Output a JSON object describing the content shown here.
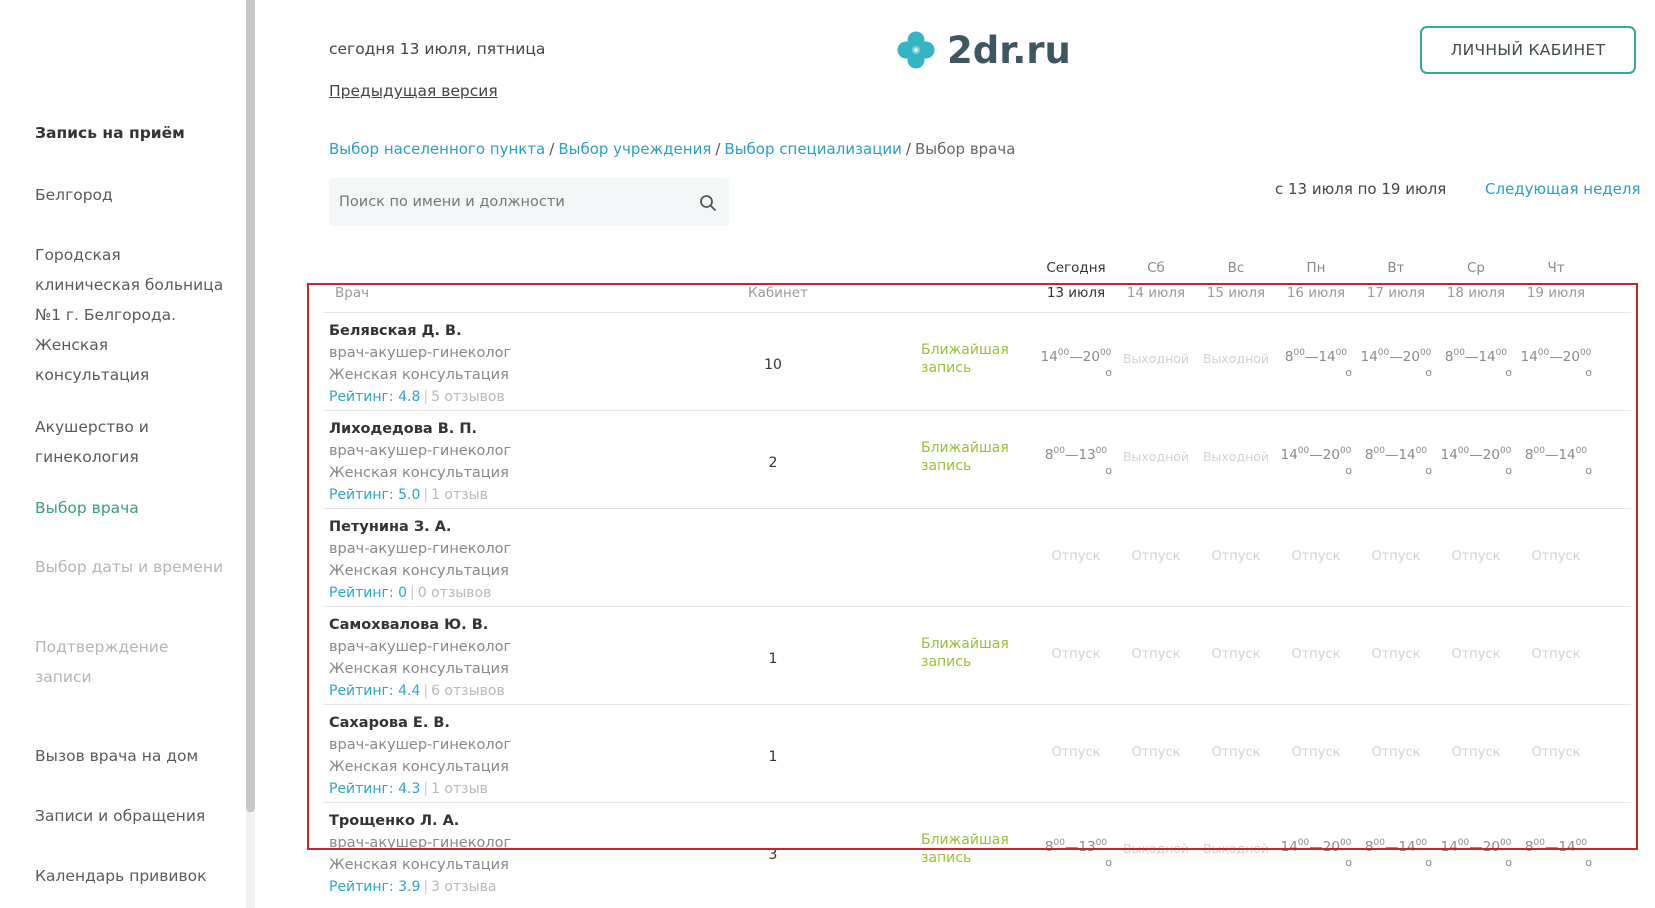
{
  "sidebar": {
    "items": [
      {
        "label": "Запись на приём",
        "state": "head"
      },
      {
        "label": "Белгород",
        "state": "normal"
      },
      {
        "label": "Городская клиническая больница №1 г. Белгорода. Женская консультация",
        "state": "normal"
      },
      {
        "label": "Акушерство и гинекология",
        "state": "normal"
      },
      {
        "label": "Выбор врача",
        "state": "active"
      },
      {
        "label": "Выбор даты и времени",
        "state": "muted"
      },
      {
        "label": "Подтверждение записи",
        "state": "muted"
      },
      {
        "label": "Вызов врача на дом",
        "state": "normal"
      },
      {
        "label": "Записи и обращения",
        "state": "normal"
      },
      {
        "label": "Календарь прививок",
        "state": "normal"
      }
    ]
  },
  "header": {
    "today": "сегодня 13 июля, пятница",
    "prev_version": "Предыдущая версия",
    "logo_text": "2dr.ru",
    "cabinet_button": "ЛИЧНЫЙ КАБИНЕТ"
  },
  "breadcrumb": {
    "links": [
      "Выбор населенного пункта",
      "Выбор учреждения",
      "Выбор специализации"
    ],
    "current": "Выбор врача",
    "separator": "/"
  },
  "search": {
    "placeholder": "Поиск по имени и должности"
  },
  "week": {
    "range": "с 13 июля по 19 июля",
    "next": "Следующая неделя"
  },
  "table": {
    "col_doctor": "Врач",
    "col_cabinet": "Кабинет",
    "days": [
      {
        "name": "Сегодня",
        "date": "13 июля",
        "today": true
      },
      {
        "name": "Сб",
        "date": "14 июля",
        "today": false
      },
      {
        "name": "Вс",
        "date": "15 июля",
        "today": false
      },
      {
        "name": "Пн",
        "date": "16 июля",
        "today": false
      },
      {
        "name": "Вт",
        "date": "17 июля",
        "today": false
      },
      {
        "name": "Ср",
        "date": "18 июля",
        "today": false
      },
      {
        "name": "Чт",
        "date": "19 июля",
        "today": false
      }
    ],
    "nearest_label": "Ближайшая запись",
    "rating_prefix": "Рейтинг:",
    "rows": [
      {
        "name": "Белявская Д. В.",
        "role": "врач-акушер-гинеколог",
        "dept": "Женская консультация",
        "rating": "4.8",
        "reviews": "5 отзывов",
        "cabinet": "10",
        "nearest": true,
        "slots": [
          {
            "type": "time",
            "from": "14",
            "to": "20"
          },
          {
            "type": "off",
            "text": "Выходной"
          },
          {
            "type": "off",
            "text": "Выходной"
          },
          {
            "type": "time",
            "from": "8",
            "to": "14"
          },
          {
            "type": "time",
            "from": "14",
            "to": "20"
          },
          {
            "type": "time",
            "from": "8",
            "to": "14"
          },
          {
            "type": "time",
            "from": "14",
            "to": "20"
          }
        ]
      },
      {
        "name": "Лиходедова В. П.",
        "role": "врач-акушер-гинеколог",
        "dept": "Женская консультация",
        "rating": "5.0",
        "reviews": "1 отзыв",
        "cabinet": "2",
        "nearest": true,
        "slots": [
          {
            "type": "time",
            "from": "8",
            "to": "13"
          },
          {
            "type": "off",
            "text": "Выходной"
          },
          {
            "type": "off",
            "text": "Выходной"
          },
          {
            "type": "time",
            "from": "14",
            "to": "20"
          },
          {
            "type": "time",
            "from": "8",
            "to": "14"
          },
          {
            "type": "time",
            "from": "14",
            "to": "20"
          },
          {
            "type": "time",
            "from": "8",
            "to": "14"
          }
        ]
      },
      {
        "name": "Петунина З. А.",
        "role": "врач-акушер-гинеколог",
        "dept": "Женская консультация",
        "rating": "0",
        "reviews": "0 отзывов",
        "cabinet": "",
        "nearest": false,
        "slots": [
          {
            "type": "leave",
            "text": "Отпуск"
          },
          {
            "type": "leave",
            "text": "Отпуск"
          },
          {
            "type": "leave",
            "text": "Отпуск"
          },
          {
            "type": "leave",
            "text": "Отпуск"
          },
          {
            "type": "leave",
            "text": "Отпуск"
          },
          {
            "type": "leave",
            "text": "Отпуск"
          },
          {
            "type": "leave",
            "text": "Отпуск"
          }
        ]
      },
      {
        "name": "Самохвалова Ю. В.",
        "role": "врач-акушер-гинеколог",
        "dept": "Женская консультация",
        "rating": "4.4",
        "reviews": "6 отзывов",
        "cabinet": "1",
        "nearest": true,
        "slots": [
          {
            "type": "leave",
            "text": "Отпуск"
          },
          {
            "type": "leave",
            "text": "Отпуск"
          },
          {
            "type": "leave",
            "text": "Отпуск"
          },
          {
            "type": "leave",
            "text": "Отпуск"
          },
          {
            "type": "leave",
            "text": "Отпуск"
          },
          {
            "type": "leave",
            "text": "Отпуск"
          },
          {
            "type": "leave",
            "text": "Отпуск"
          }
        ]
      },
      {
        "name": "Сахарова Е. В.",
        "role": "врач-акушер-гинеколог",
        "dept": "Женская консультация",
        "rating": "4.3",
        "reviews": "1 отзыв",
        "cabinet": "1",
        "nearest": false,
        "slots": [
          {
            "type": "leave",
            "text": "Отпуск"
          },
          {
            "type": "leave",
            "text": "Отпуск"
          },
          {
            "type": "leave",
            "text": "Отпуск"
          },
          {
            "type": "leave",
            "text": "Отпуск"
          },
          {
            "type": "leave",
            "text": "Отпуск"
          },
          {
            "type": "leave",
            "text": "Отпуск"
          },
          {
            "type": "leave",
            "text": "Отпуск"
          }
        ]
      },
      {
        "name": "Трощенко Л. А.",
        "role": "врач-акушер-гинеколог",
        "dept": "Женская консультация",
        "rating": "3.9",
        "reviews": "3 отзыва",
        "cabinet": "3",
        "nearest": true,
        "slots": [
          {
            "type": "time",
            "from": "8",
            "to": "13"
          },
          {
            "type": "off",
            "text": "Выходной"
          },
          {
            "type": "off",
            "text": "Выходной"
          },
          {
            "type": "time",
            "from": "14",
            "to": "20"
          },
          {
            "type": "time",
            "from": "8",
            "to": "14"
          },
          {
            "type": "time",
            "from": "14",
            "to": "20"
          },
          {
            "type": "time",
            "from": "8",
            "to": "14"
          }
        ]
      }
    ]
  },
  "colors": {
    "accent": "#2a9fc6",
    "teal": "#3aa59e",
    "nearest": "#9abf38",
    "highlight": "#c0282d"
  }
}
